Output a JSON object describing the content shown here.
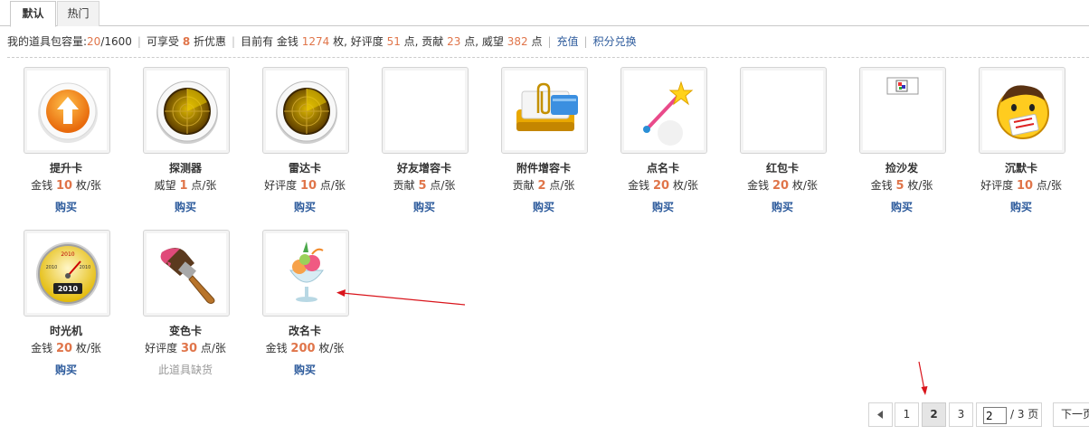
{
  "tabs": [
    {
      "label": "默认",
      "active": true
    },
    {
      "label": "热门",
      "active": false
    }
  ],
  "info": {
    "capacity_label": "我的道具包容量:",
    "capacity_used": "20",
    "capacity_total": "/1600",
    "discount_prefix": "可享受",
    "discount_value": "8",
    "discount_suffix": "折优惠",
    "have_prefix": "目前有 金钱",
    "money": "1274",
    "money_unit": "枚, 好评度",
    "rep": "51",
    "rep_unit": "点, 贡献",
    "contrib": "23",
    "contrib_unit": "点, 威望",
    "prestige": "382",
    "prestige_unit": "点",
    "recharge_link": "充值",
    "exchange_link": "积分兑换"
  },
  "items": [
    {
      "name": "提升卡",
      "currency": "金钱",
      "amount": "10",
      "unit": "枚/张",
      "action": "购买",
      "icon": "up-arrow-icon"
    },
    {
      "name": "探测器",
      "currency": "威望",
      "amount": "1",
      "unit": "点/张",
      "action": "购买",
      "icon": "radar-icon"
    },
    {
      "name": "雷达卡",
      "currency": "好评度",
      "amount": "10",
      "unit": "点/张",
      "action": "购买",
      "icon": "radar-icon"
    },
    {
      "name": "好友增容卡",
      "currency": "贡献",
      "amount": "5",
      "unit": "点/张",
      "action": "购买",
      "icon": "blank-icon"
    },
    {
      "name": "附件增容卡",
      "currency": "贡献",
      "amount": "2",
      "unit": "点/张",
      "action": "购买",
      "icon": "paperclip-tray-icon"
    },
    {
      "name": "点名卡",
      "currency": "金钱",
      "amount": "20",
      "unit": "枚/张",
      "action": "购买",
      "icon": "magic-wand-icon"
    },
    {
      "name": "红包卡",
      "currency": "金钱",
      "amount": "20",
      "unit": "枚/张",
      "action": "购买",
      "icon": "blank-icon"
    },
    {
      "name": "捡沙发",
      "currency": "金钱",
      "amount": "5",
      "unit": "枚/张",
      "action": "购买",
      "icon": "broken-image-icon"
    },
    {
      "name": "沉默卡",
      "currency": "好评度",
      "amount": "10",
      "unit": "点/张",
      "action": "购买",
      "icon": "silenced-face-icon"
    },
    {
      "name": "时光机",
      "currency": "金钱",
      "amount": "20",
      "unit": "枚/张",
      "action": "购买",
      "icon": "time-gauge-icon"
    },
    {
      "name": "变色卡",
      "currency": "好评度",
      "amount": "30",
      "unit": "点/张",
      "action": "此道具缺货",
      "soldout": true,
      "icon": "paintbrush-icon"
    },
    {
      "name": "改名卡",
      "currency": "金钱",
      "amount": "200",
      "unit": "枚/张",
      "action": "购买",
      "icon": "ice-cream-icon"
    }
  ],
  "gauge_text": {
    "top": "2010",
    "left": "2010",
    "right": "2010",
    "display": "2010"
  },
  "pager": {
    "pages": [
      "1",
      "2",
      "3"
    ],
    "current": "2",
    "input_value": "2",
    "total_label": "/ 3 页",
    "next_label": "下一页"
  },
  "colors": {
    "accent_orange": "#e0754a",
    "link_blue": "#2d5b9c",
    "arrow_red": "#d9141b"
  }
}
